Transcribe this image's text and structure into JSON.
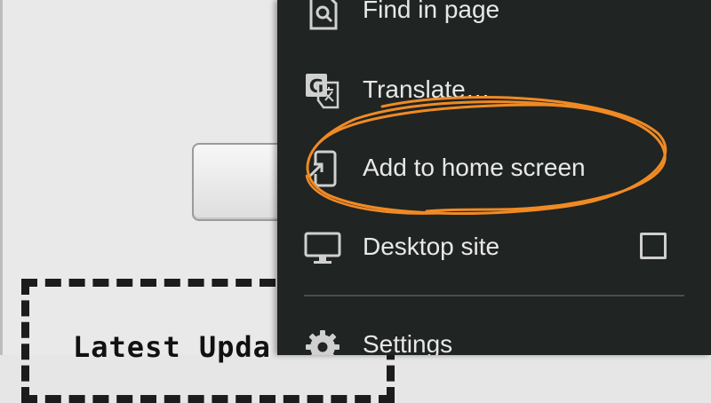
{
  "page": {
    "update_box_title": "Latest Upda"
  },
  "menu": {
    "items": [
      {
        "label": "Find in page",
        "icon": "find-in-page-icon"
      },
      {
        "label": "Translate…",
        "icon": "translate-icon"
      },
      {
        "label": "Add to home screen",
        "icon": "add-to-home-screen-icon"
      },
      {
        "label": "Desktop site",
        "icon": "desktop-icon",
        "checked": false
      },
      {
        "label": "Settings",
        "icon": "gear-icon"
      }
    ]
  },
  "colors": {
    "menu_background": "#202422",
    "menu_text": "#e8e8e8",
    "annotation": "#f08a24"
  }
}
